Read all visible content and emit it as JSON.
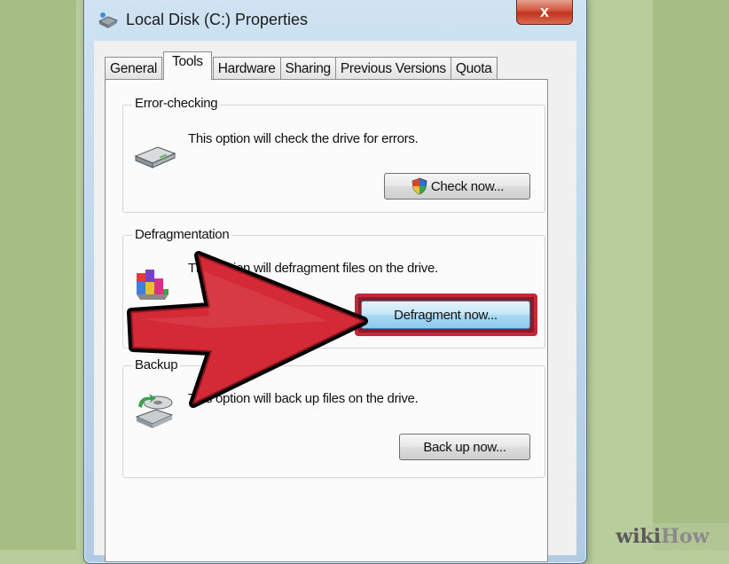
{
  "window": {
    "title": "Local Disk (C:) Properties",
    "close_label": "x"
  },
  "tabs": [
    {
      "label": "General",
      "active": false
    },
    {
      "label": "Tools",
      "active": true
    },
    {
      "label": "Hardware",
      "active": false
    },
    {
      "label": "Sharing",
      "active": false
    },
    {
      "label": "Previous Versions",
      "active": false
    },
    {
      "label": "Quota",
      "active": false
    }
  ],
  "error_checking": {
    "title": "Error-checking",
    "description": "This option will check the drive for errors.",
    "button_label": "Check now...",
    "icon": "drive-icon"
  },
  "defragmentation": {
    "title": "Defragmentation",
    "description": "This option will defragment files on the drive.",
    "button_label": "Defragment now...",
    "icon": "defrag-icon"
  },
  "backup": {
    "title": "Backup",
    "description": "This option will back up files on the drive.",
    "button_label": "Back up now...",
    "icon": "backup-icon"
  },
  "annotation": {
    "arrow_color": "#d42a36",
    "highlight_color": "#c4283a"
  },
  "watermark": {
    "part1": "wiki",
    "part2": "How"
  }
}
